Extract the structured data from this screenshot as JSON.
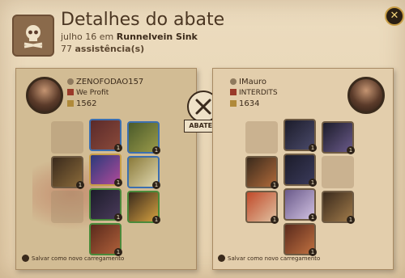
{
  "header": {
    "title": "Detalhes do abate",
    "date_text": "julho 16 em",
    "location": "Runnelvein Sink",
    "assists_count": "77",
    "assists_label": "assistência(s)"
  },
  "center": {
    "label": "ABATEU"
  },
  "killer": {
    "name": "ZENOFODAO157",
    "guild": "We Profit",
    "fame": "1562",
    "save_label": "Salvar como novo carregamento"
  },
  "victim": {
    "name": "IMauro",
    "guild": "INTERDITS",
    "fame": "1634",
    "save_label": "Salvar como novo carregamento"
  },
  "colors": {
    "common": "#6f5b43",
    "uncommon": "#4a8a3a",
    "rare": "#3c6fb0",
    "exceptional": "#8b4ab0",
    "accent": "#c89d45"
  }
}
